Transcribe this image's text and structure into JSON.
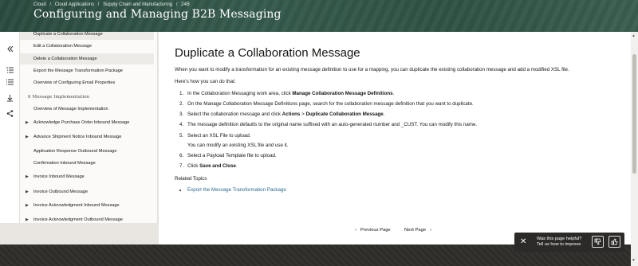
{
  "header": {
    "breadcrumbs": [
      "Cloud",
      "/",
      "Cloud Applications",
      "/",
      "Supply Chain and Manufacturing",
      "/",
      "24B"
    ],
    "title": "Configuring and Managing B2B Messaging"
  },
  "rail": {
    "icons": [
      "collapse-icon",
      "toc-icon",
      "list-icon",
      "download-icon",
      "share-icon"
    ]
  },
  "nav": {
    "items": [
      {
        "label": "Duplicate a Collaboration Message",
        "highlight": true
      },
      {
        "label": "Edit a Collaboration Message"
      },
      {
        "label": "Delete a Collaboration Message",
        "highlight": true
      },
      {
        "label": "Export the Message Transformation Package"
      },
      {
        "label": "Overview of Configuring Email Properties"
      },
      {
        "label": "6 Message Implementation",
        "group": true
      },
      {
        "label": "Overview of Message Implementation"
      },
      {
        "label": "Acknowledge Purchase Order Inbound Message",
        "caret": true
      },
      {
        "label": "Advance Shipment Notice Inbound Message",
        "caret": true
      },
      {
        "label": "Application Response Outbound Message"
      },
      {
        "label": "Confirmation Inbound Message"
      },
      {
        "label": "Invoice Inbound Message",
        "caret": true
      },
      {
        "label": "Invoice Outbound Message",
        "caret": true
      },
      {
        "label": "Invoice Acknowledgment Inbound Message",
        "caret": true
      },
      {
        "label": "Invoice Acknowledgment Outbound Message",
        "caret": true
      }
    ]
  },
  "main": {
    "heading": "Duplicate a Collaboration Message",
    "intro": "When you want to modify a transformation for an existing message definition to use for a mapping, you can duplicate the existing collaboration message and add a modified XSL file.",
    "howto": "Here's how you can do that:",
    "steps": [
      {
        "n": "1.",
        "pre": "In the Collaboration Messaging work area, click ",
        "bold": "Manage Collaboration Message Definitions",
        "post": "."
      },
      {
        "n": "2.",
        "pre": "On the Manage Collaboration Message Definitions page, search for the collaboration message definition that you want to duplicate.",
        "bold": "",
        "post": ""
      },
      {
        "n": "3.",
        "pre": "Select the collaboration message and click ",
        "bold": "Actions",
        "mid": " > ",
        "bold2": "Duplicate Collaboration Message",
        "post": "."
      },
      {
        "n": "4.",
        "pre": "The message definition defaults to the original name suffixed with an auto-generated number and _CUST. You can modify this name.",
        "bold": "",
        "post": ""
      },
      {
        "n": "5.",
        "pre": "Select an XSL File to upload.",
        "bold": "",
        "post": ""
      },
      {
        "n": "",
        "pre": "You can modify an existing XSL file and use it.",
        "bold": "",
        "post": ""
      },
      {
        "n": "6.",
        "pre": "Select a Payload Template file to upload.",
        "bold": "",
        "post": ""
      },
      {
        "n": "7.",
        "pre": "Click ",
        "bold": "Save and Close",
        "post": "."
      }
    ],
    "related_title": "Related Topics",
    "related_links": [
      "Export the Message Transformation Package"
    ],
    "prev_label": "Previous Page",
    "next_label": "Next Page"
  },
  "feedback": {
    "line1": "Was this page helpful?",
    "line2": "Tell us how to improve",
    "close": "✕",
    "down": "👎",
    "up": "👍"
  }
}
